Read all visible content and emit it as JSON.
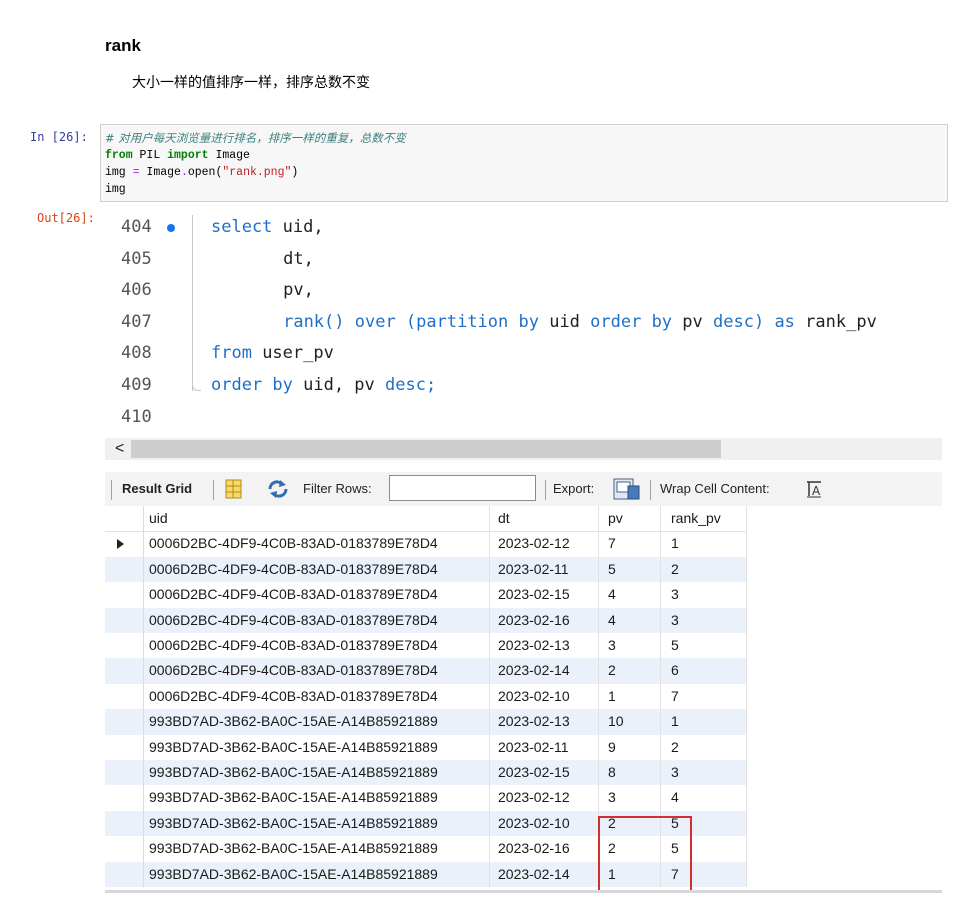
{
  "markdown": {
    "heading": "rank",
    "text": "大小一样的值排序一样，排序总数不变"
  },
  "cell": {
    "in_prompt": "In  [26]:",
    "out_prompt": "Out[26]:",
    "code": [
      {
        "parts": [
          {
            "t": "# 对用户每天浏览量进行排名，排序一样的重复，总数不变",
            "c": "cm-comment"
          }
        ]
      },
      {
        "parts": [
          {
            "t": "from",
            "c": "cm-kw"
          },
          {
            "t": " PIL ",
            "c": ""
          },
          {
            "t": "import",
            "c": "cm-kw"
          },
          {
            "t": " Image",
            "c": ""
          }
        ]
      },
      {
        "parts": [
          {
            "t": "img ",
            "c": ""
          },
          {
            "t": "=",
            "c": "cm-op"
          },
          {
            "t": " Image",
            "c": ""
          },
          {
            "t": ".",
            "c": "cm-op"
          },
          {
            "t": "open(",
            "c": ""
          },
          {
            "t": "\"rank.png\"",
            "c": "cm-str"
          },
          {
            "t": ")",
            "c": ""
          }
        ]
      },
      {
        "parts": [
          {
            "t": "img",
            "c": ""
          }
        ]
      }
    ]
  },
  "editor": {
    "lines": [
      {
        "no": "404",
        "breakpoint": true,
        "indent": 0,
        "parts": [
          {
            "t": "select",
            "k": true
          },
          {
            "t": " uid,",
            "k": false
          }
        ]
      },
      {
        "no": "405",
        "breakpoint": false,
        "indent": 7,
        "parts": [
          {
            "t": "dt,",
            "k": false
          }
        ]
      },
      {
        "no": "406",
        "breakpoint": false,
        "indent": 7,
        "parts": [
          {
            "t": "pv,",
            "k": false
          }
        ]
      },
      {
        "no": "407",
        "breakpoint": false,
        "indent": 7,
        "parts": [
          {
            "t": "rank() over (partition by",
            "k": true
          },
          {
            "t": " uid ",
            "k": false
          },
          {
            "t": "order by",
            "k": true
          },
          {
            "t": " pv ",
            "k": false
          },
          {
            "t": "desc)",
            "k": true
          },
          {
            "t": " ",
            "k": false
          },
          {
            "t": "as",
            "k": true
          },
          {
            "t": " rank_pv",
            "k": false
          }
        ]
      },
      {
        "no": "408",
        "breakpoint": false,
        "indent": 0,
        "parts": [
          {
            "t": "from",
            "k": true
          },
          {
            "t": " user_pv",
            "k": false
          }
        ]
      },
      {
        "no": "409",
        "breakpoint": false,
        "indent": 0,
        "parts": [
          {
            "t": "order by",
            "k": true
          },
          {
            "t": " uid, pv ",
            "k": false
          },
          {
            "t": "desc;",
            "k": true
          }
        ]
      },
      {
        "no": "410",
        "breakpoint": false,
        "indent": 0,
        "parts": []
      }
    ],
    "scroll_left_arrow": "<"
  },
  "toolbar": {
    "result_grid": "Result Grid",
    "filter_rows": "Filter Rows:",
    "filter_value": "",
    "export": "Export:",
    "wrap": "Wrap Cell Content:"
  },
  "grid": {
    "columns": [
      "uid",
      "dt",
      "pv",
      "rank_pv"
    ],
    "rows": [
      [
        "0006D2BC-4DF9-4C0B-83AD-0183789E78D4",
        "2023-02-12",
        "7",
        "1"
      ],
      [
        "0006D2BC-4DF9-4C0B-83AD-0183789E78D4",
        "2023-02-11",
        "5",
        "2"
      ],
      [
        "0006D2BC-4DF9-4C0B-83AD-0183789E78D4",
        "2023-02-15",
        "4",
        "3"
      ],
      [
        "0006D2BC-4DF9-4C0B-83AD-0183789E78D4",
        "2023-02-16",
        "4",
        "3"
      ],
      [
        "0006D2BC-4DF9-4C0B-83AD-0183789E78D4",
        "2023-02-13",
        "3",
        "5"
      ],
      [
        "0006D2BC-4DF9-4C0B-83AD-0183789E78D4",
        "2023-02-14",
        "2",
        "6"
      ],
      [
        "0006D2BC-4DF9-4C0B-83AD-0183789E78D4",
        "2023-02-10",
        "1",
        "7"
      ],
      [
        "993BD7AD-3B62-BA0C-15AE-A14B85921889",
        "2023-02-13",
        "10",
        "1"
      ],
      [
        "993BD7AD-3B62-BA0C-15AE-A14B85921889",
        "2023-02-11",
        "9",
        "2"
      ],
      [
        "993BD7AD-3B62-BA0C-15AE-A14B85921889",
        "2023-02-15",
        "8",
        "3"
      ],
      [
        "993BD7AD-3B62-BA0C-15AE-A14B85921889",
        "2023-02-12",
        "3",
        "4"
      ],
      [
        "993BD7AD-3B62-BA0C-15AE-A14B85921889",
        "2023-02-10",
        "2",
        "5"
      ],
      [
        "993BD7AD-3B62-BA0C-15AE-A14B85921889",
        "2023-02-16",
        "2",
        "5"
      ],
      [
        "993BD7AD-3B62-BA0C-15AE-A14B85921889",
        "2023-02-14",
        "1",
        "7"
      ]
    ],
    "selected_row": 0
  },
  "colors": {
    "keyword": "#1f6fc9",
    "highlight_box": "#d32f2f",
    "alt_row": "#ebf1fa"
  }
}
